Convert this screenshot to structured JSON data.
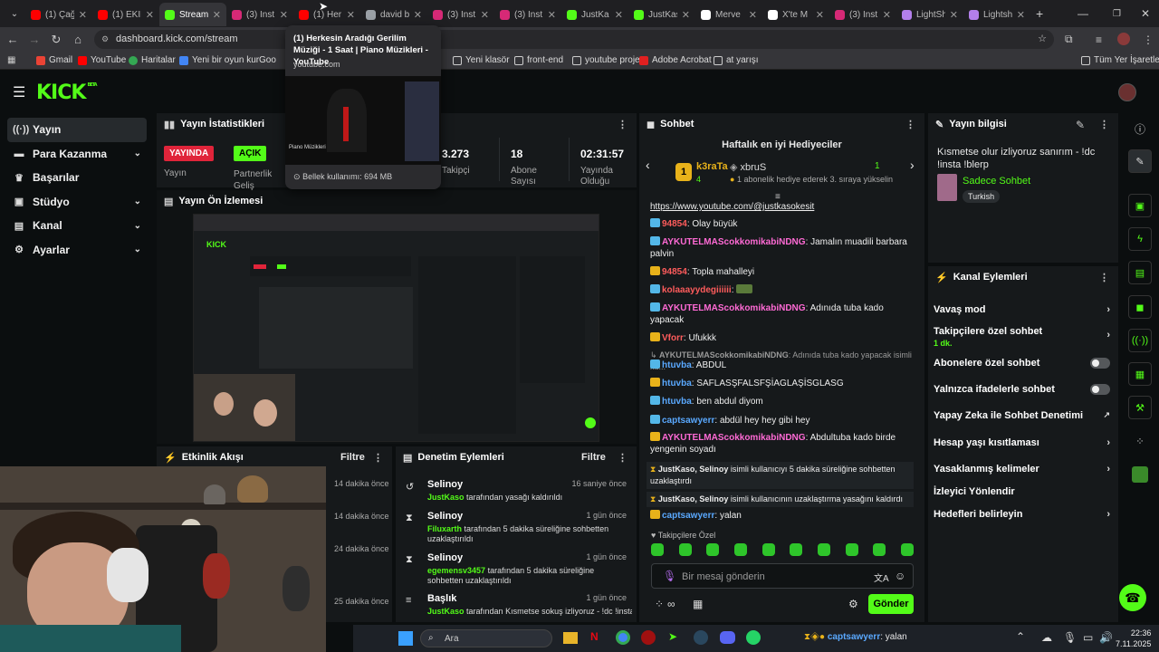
{
  "browser": {
    "tabs": [
      {
        "label": "(1) Çağ",
        "color": "#ff0000",
        "icon": "youtube-icon"
      },
      {
        "label": "(1) EKİP",
        "color": "#ff0000",
        "icon": "youtube-icon"
      },
      {
        "label": "Stream",
        "color": "#53fc18",
        "icon": "kick-icon",
        "active": true
      },
      {
        "label": "(3) Inst",
        "color": "#d62976",
        "icon": "instagram-icon"
      },
      {
        "label": "(1) Her",
        "color": "#ff0000",
        "icon": "youtube-icon"
      },
      {
        "label": "david b",
        "color": "#9aa0a6",
        "icon": "google-icon"
      },
      {
        "label": "(3) Inst",
        "color": "#d62976",
        "icon": "instagram-icon"
      },
      {
        "label": "(3) Inst",
        "color": "#d62976",
        "icon": "instagram-icon"
      },
      {
        "label": "JustKa",
        "color": "#53fc18",
        "icon": "kick-icon"
      },
      {
        "label": "JustKas",
        "color": "#53fc18",
        "icon": "kick-icon"
      },
      {
        "label": "Merve",
        "color": "#ffffff",
        "icon": "x-icon"
      },
      {
        "label": "X'te M",
        "color": "#ffffff",
        "icon": "x-icon"
      },
      {
        "label": "(3) Inst",
        "color": "#d62976",
        "icon": "instagram-icon"
      },
      {
        "label": "LightSh",
        "color": "#b37feb",
        "icon": "lightshot-icon"
      },
      {
        "label": "Lightsh",
        "color": "#b37feb",
        "icon": "lightshot-icon"
      }
    ],
    "url": "dashboard.kick.com/stream",
    "bookmarks": [
      "Gmail",
      "YouTube",
      "Haritalar",
      "Yeni bir oyun kur",
      "Goo",
      "Yeni klasör",
      "front-end",
      "youtube proje",
      "Adobe Acrobat",
      "at yarışı"
    ],
    "bookmarks_right": "Tüm Yer İşaretleri",
    "tooltip": {
      "title": "(1) Herkesin Aradığı Gerilim Müziği - 1 Saat | Piano Müzikleri - YouTube",
      "domain": "youtube.com",
      "preview_caption": "Piano Müzikleri",
      "memory": "Bellek kullanımı: 694 MB"
    }
  },
  "kick": {
    "logo": "KICK",
    "logo_beta": "BETA",
    "sidebar": [
      {
        "label": "Yayın",
        "icon": "stream-icon",
        "selected": true
      },
      {
        "label": "Para Kazanma",
        "icon": "money-icon",
        "chevron": true
      },
      {
        "label": "Başarılar",
        "icon": "trophy-icon"
      },
      {
        "label": "Stüdyo",
        "icon": "studio-icon",
        "chevron": true
      },
      {
        "label": "Kanal",
        "icon": "channel-icon",
        "chevron": true
      },
      {
        "label": "Ayarlar",
        "icon": "settings-icon",
        "chevron": true
      }
    ],
    "stats": {
      "title": "Yayın İstatistikleri",
      "items": [
        {
          "value": "YAYINDA",
          "label": "Yayın",
          "badge": "red"
        },
        {
          "value": "AÇIK",
          "label": "Partnerlik Geliş",
          "badge": "green"
        },
        {
          "value": "3.273",
          "label": "Takipçi"
        },
        {
          "value": "18",
          "label": "Abone Sayısı"
        },
        {
          "value": "02:31:57",
          "label": "Yayında Olduğu"
        }
      ]
    },
    "preview": {
      "title": "Yayın Ön İzlemesi"
    },
    "activity": {
      "title": "Etkinlik Akışı",
      "filter": "Filtre",
      "times": [
        "14 dakika önce",
        "14 dakika önce",
        "24 dakika önce",
        "25 dakika önce"
      ]
    },
    "moderation": {
      "title": "Denetim Eylemleri",
      "filter": "Filtre",
      "items": [
        {
          "name": "Selinoy",
          "time": "16 saniye önce",
          "actor": "JustKaso",
          "text": "tarafından yasağı kaldırıldı",
          "icon": "undo-icon"
        },
        {
          "name": "Selinoy",
          "time": "1 gün önce",
          "actor": "Filuxarth",
          "text": "tarafından 5 dakika süreliğine sohbetten uzaklaştırıldı",
          "icon": "hourglass-icon"
        },
        {
          "name": "Selinoy",
          "time": "1 gün önce",
          "actor": "egemensv3457",
          "text": "tarafından 5 dakika süreliğine sohbetten uzaklaştırıldı",
          "icon": "hourglass-icon"
        },
        {
          "name": "Başlık",
          "time": "1 gün önce",
          "actor": "JustKaso",
          "text": "tarafından Kısmetse sokuş izliyoruz - !dc !insta",
          "icon": "text-icon"
        }
      ]
    },
    "chat": {
      "title": "Sohbet",
      "gifters_title": "Haftalık en iyi Hediyeciler",
      "gifter_rank": "1",
      "gifter_name": "k3raTa",
      "gifter_count": "4",
      "gifter2_name": "xbruS",
      "gifter2_count": "1",
      "gifter_note": "1 abonelik hediye ederek 3. sıraya yükselin",
      "messages": [
        {
          "user": "",
          "text": "https://www.youtube.com/@justkasokesit",
          "link": true
        },
        {
          "user": "94854",
          "text": "Olay büyük",
          "color": "#ff5c5c"
        },
        {
          "user": "AYKUTELMAScokkomikabiNDNG",
          "text": "Jamalın muadili barbara palvin",
          "color": "#ff6ad5"
        },
        {
          "user": "94854",
          "text": "Topla mahalleyi",
          "color": "#ff5c5c"
        },
        {
          "user": "kolaaayydegiiiiii",
          "text": "",
          "color": "#ff5c5c"
        },
        {
          "user": "AYKUTELMAScokkomikabiNDNG",
          "text": "Adınıda tuba kado yapacak",
          "color": "#ff6ad5"
        },
        {
          "user": "Vforr",
          "text": "Ufukkk",
          "color": "#ff5c5c"
        },
        {
          "user": "AYKUTELMAScokkomikabiNDNG",
          "text": "Adınıda tuba kado yapacak isimli ku...",
          "color": "#999999",
          "reply": true
        },
        {
          "user": "htuvba",
          "text": "ABDUL",
          "color": "#5aa9ff"
        },
        {
          "user": "htuvba",
          "text": "SAFLASŞFALSFŞİAGLAŞİSGLASG",
          "color": "#5aa9ff"
        },
        {
          "user": "htuvba",
          "text": "ben abdul diyom",
          "color": "#5aa9ff"
        },
        {
          "user": "captsawyerr",
          "text": "abdül hey hey gibi hey",
          "color": "#5aa9ff"
        },
        {
          "user": "AYKUTELMAScokkomikabiNDNG",
          "text": "Abdultuba kado birde yengenin soyadı",
          "color": "#ff6ad5"
        },
        {
          "user": "JustKaso, Selinoy",
          "text": "isimli kullanıcıyı 5 dakika süreliğine sohbetten uzaklaştırdı",
          "color": "#eeeeee",
          "system": true
        },
        {
          "user": "JustKaso, Selinoy",
          "text": "isimli kullanıcının uzaklaştırma yasağını kaldırdı",
          "color": "#eeeeee",
          "system": true
        },
        {
          "user": "captsawyerr",
          "text": "yalan",
          "color": "#5aa9ff"
        }
      ],
      "followers_mode": "Takipçilere Özel",
      "input_placeholder": "Bir mesaj gönderin",
      "send_label": "Gönder"
    },
    "stream_info": {
      "title": "Yayın bilgisi",
      "stream_title": "Kısmetse olur izliyoruz sanırım - !dc !insta !blerp",
      "category": "Sadece Sohbet",
      "language": "Turkish"
    },
    "channel_actions": {
      "title": "Kanal Eylemleri",
      "items": [
        {
          "label": "Vavaş mod",
          "type": "chevron"
        },
        {
          "label": "Takipçilere özel sohbet",
          "sub": "1 dk.",
          "type": "chevron"
        },
        {
          "label": "Abonelere özel sohbet",
          "type": "toggle"
        },
        {
          "label": "Yalnızca ifadelerle sohbet",
          "type": "toggle"
        },
        {
          "label": "Yapay Zeka ile Sohbet Denetimi",
          "type": "external"
        },
        {
          "label": "Hesap yaşı kısıtlaması",
          "type": "chevron"
        },
        {
          "label": "Yasaklanmış kelimeler",
          "type": "chevron"
        },
        {
          "label": "İzleyici Yönlendir",
          "type": "none"
        },
        {
          "label": "Hedefleri belirleyin",
          "type": "chevron"
        }
      ]
    }
  },
  "taskbar": {
    "search_placeholder": "Ara",
    "notification_user": "captsawyerr",
    "notification_text": "yalan",
    "time": "22:36",
    "date": "7.11.2025"
  }
}
